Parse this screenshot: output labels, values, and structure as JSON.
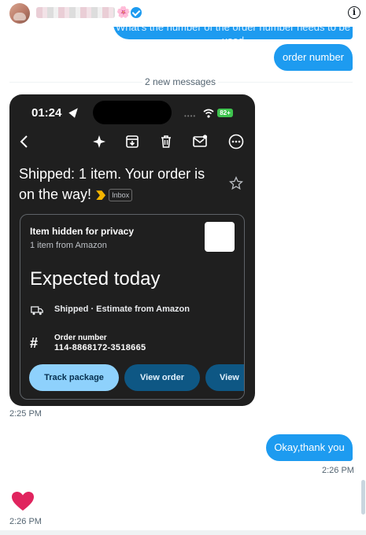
{
  "header": {
    "name_blurred": true,
    "emoji": "🌸"
  },
  "messages": {
    "cut_bubble": "What's the number of the order number needs to be used",
    "order_number_bubble": "order number",
    "divider": "2 new messages",
    "time_image": "2:25 PM",
    "okay_bubble": "Okay,thank you",
    "time_okay": "2:26 PM",
    "time_heart": "2:26 PM"
  },
  "phone": {
    "status_time": "01:24",
    "battery": "82+",
    "subject": "Shipped: 1 item. Your order is on the way!",
    "label": "Inbox",
    "card": {
      "item_title": "Item hidden for privacy",
      "item_sub": "1 item from Amazon",
      "expected": "Expected today",
      "shipped": "Shipped · Estimate from Amazon",
      "order_label": "Order number",
      "order_number": "114-8868172-3518665",
      "buttons": [
        "Track package",
        "View order",
        "View"
      ]
    }
  },
  "colors": {
    "accent": "#1d9bf0",
    "heart": "#e0245e"
  }
}
